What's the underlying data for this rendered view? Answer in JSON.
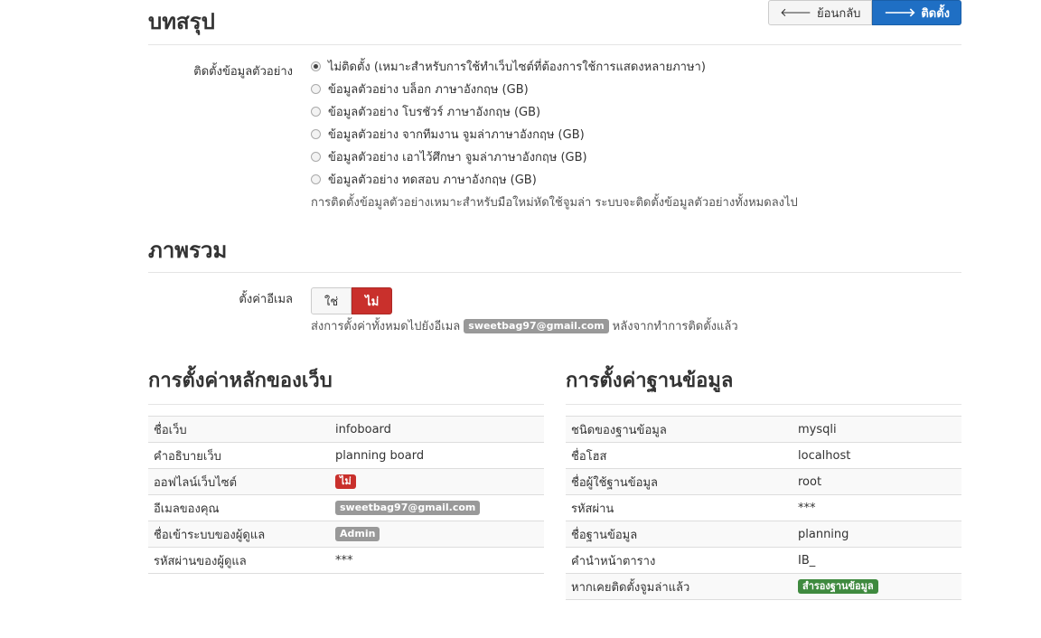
{
  "summary": {
    "title": "บทสรุป",
    "back_label": "ย้อนกลับ",
    "install_label": "ติดตั้ง"
  },
  "sample_data": {
    "label": "ติดตั้งข้อมูลตัวอย่าง",
    "options": [
      {
        "text": "ไม่ติดตั้ง (เหมาะสำหรับการใช้ทำเว็บไซต์ที่ต้องการใช้การแสดงหลายภาษา)",
        "checked": true
      },
      {
        "text": "ข้อมูลตัวอย่าง บล็อก ภาษาอังกฤษ (GB)",
        "checked": false
      },
      {
        "text": "ข้อมูลตัวอย่าง โบรชัวร์ ภาษาอังกฤษ (GB)",
        "checked": false
      },
      {
        "text": "ข้อมูลตัวอย่าง จากทีมงาน จูมล่าภาษาอังกฤษ (GB)",
        "checked": false
      },
      {
        "text": "ข้อมูลตัวอย่าง เอาไว้ศึกษา จูมล่าภาษาอังกฤษ (GB)",
        "checked": false
      },
      {
        "text": "ข้อมูลตัวอย่าง ทดสอบ ภาษาอังกฤษ (GB)",
        "checked": false
      }
    ],
    "help": "การติดตั้งข้อมูลตัวอย่างเหมาะสำหรับมือใหม่หัดใช้จูมล่า ระบบจะติดตั้งข้อมูลตัวอย่างทั้งหมดลงไป"
  },
  "overview": {
    "title": "ภาพรวม",
    "email_label": "ตั้งค่าอีเมล",
    "yes_label": "ใช่",
    "no_label": "ไม่",
    "help_before": "ส่งการตั้งค่าทั้งหมดไปยังอีเมล",
    "help_email": "sweetbag97@gmail.com",
    "help_after": "หลังจากทำการติดตั้งแล้ว"
  },
  "site_config": {
    "title": "การตั้งค่าหลักของเว็บ",
    "rows": [
      {
        "label": "ชื่อเว็บ",
        "value": "infoboard",
        "badge": ""
      },
      {
        "label": "คำอธิบายเว็บ",
        "value": "planning board",
        "badge": ""
      },
      {
        "label": "ออฟไลน์เว็บไซต์",
        "value": "ไม่",
        "badge": "red"
      },
      {
        "label": "อีเมลของคุณ",
        "value": "sweetbag97@gmail.com",
        "badge": "gray"
      },
      {
        "label": "ชื่อเข้าระบบของผู้ดูแล",
        "value": "Admin",
        "badge": "gray"
      },
      {
        "label": "รหัสผ่านของผู้ดูแล",
        "value": "***",
        "badge": ""
      }
    ]
  },
  "db_config": {
    "title": "การตั้งค่าฐานข้อมูล",
    "rows": [
      {
        "label": "ชนิดของฐานข้อมูล",
        "value": "mysqli",
        "badge": ""
      },
      {
        "label": "ชื่อโฮส",
        "value": "localhost",
        "badge": ""
      },
      {
        "label": "ชื่อผู้ใช้ฐานข้อมูล",
        "value": "root",
        "badge": ""
      },
      {
        "label": "รหัสผ่าน",
        "value": "***",
        "badge": ""
      },
      {
        "label": "ชื่อฐานข้อมูล",
        "value": "planning",
        "badge": ""
      },
      {
        "label": "คำนำหน้าตาราง",
        "value": "IB_",
        "badge": ""
      },
      {
        "label": "หากเคยติดตั้งจูมล่าแล้ว",
        "value": "สำรองฐานข้อมูล",
        "badge": "green"
      }
    ]
  }
}
